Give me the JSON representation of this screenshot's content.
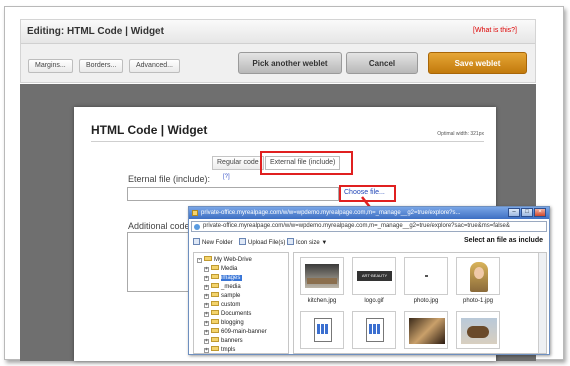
{
  "editor": {
    "title": "Editing: HTML Code | Widget",
    "help_link": "[What is this?]",
    "buttons": {
      "margins": "Margins...",
      "borders": "Borders...",
      "advanced": "Advanced...",
      "pick": "Pick another weblet",
      "cancel": "Cancel",
      "save": "Save weblet"
    }
  },
  "widget": {
    "title": "HTML Code | Widget",
    "optimal_width": "Optimal width: 321px",
    "tabs": [
      "Regular code",
      "External file (include)"
    ],
    "external_label": "Eternal file (include):",
    "help_mark": "[?]",
    "choose_file": "Choose file...",
    "additional_label": "Additional code"
  },
  "popup": {
    "window_title": "private-office.myrealpage.com/w/w=wpdemo.myrealpage.com,m=_manage__g2=true/explore?s...",
    "address": "private-office.myrealpage.com/w/w=wpdemo.myrealpage.com,m=_manage__g2=true/explore?sac=true&ms=false&",
    "toolbar": {
      "new_folder": "New Folder",
      "upload": "Upload File(s)",
      "icon_size": "Icon size ▼",
      "select_hint": "Select an file as include"
    },
    "tree": {
      "root": "My Web-Drive",
      "items": [
        "Media",
        "images",
        "_media",
        "sample",
        "custom",
        "Documents",
        "blogging",
        "609-main-banner",
        "banners",
        "tmpls"
      ],
      "selected": "images"
    },
    "files": [
      {
        "name": "kitchen.jpg",
        "icon": "kitchen-photo-thumbnail"
      },
      {
        "name": "logo.gif",
        "icon": "logo-thumbnail"
      },
      {
        "name": "photo.jpg",
        "icon": "photo-thumbnail"
      },
      {
        "name": "photo-1.jpg",
        "icon": "portrait-photo-thumbnail"
      },
      {
        "name": "",
        "icon": "document-grid-icon"
      },
      {
        "name": "",
        "icon": "document-grid-icon"
      },
      {
        "name": "",
        "icon": "interior-photo-thumbnail"
      },
      {
        "name": "",
        "icon": "animal-photo-thumbnail"
      }
    ]
  },
  "colors": {
    "save_orange": "#d58a1a",
    "highlight_red": "#e02020",
    "link_blue": "#2146b8"
  }
}
